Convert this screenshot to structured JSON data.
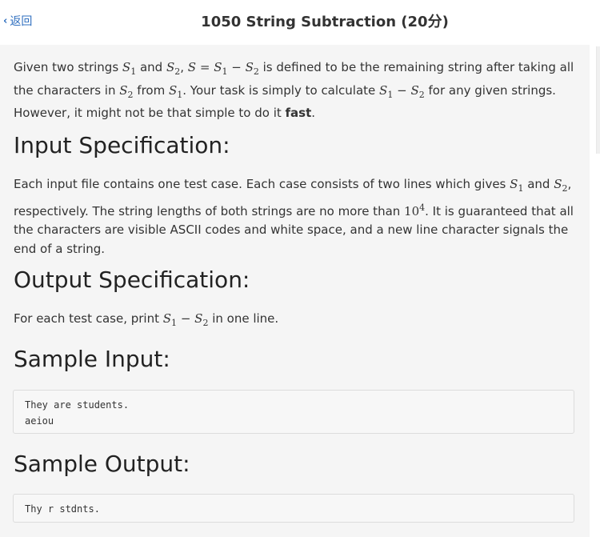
{
  "header": {
    "back_label": "返回",
    "title": "1050 String Subtraction (20分)"
  },
  "intro": {
    "t1": "Given two strings ",
    "t2": " and ",
    "t3": ", ",
    "t4": " is defined to be the remaining string after taking all the characters in ",
    "t5": " from ",
    "t6": ". Your task is simply to calculate ",
    "t7": " for any given strings. However, it might not be that simple to do it ",
    "bold": "fast",
    "t8": "."
  },
  "input_spec": {
    "heading": "Input Specification:",
    "t1": "Each input file contains one test case. Each case consists of two lines which gives ",
    "t2": " and ",
    "t3": ", respectively. The string lengths of both strings are no more than ",
    "t4": ". It is guaranteed that all the characters are visible ASCII codes and white space, and a new line character signals the end of a string."
  },
  "output_spec": {
    "heading": "Output Specification:",
    "t1": "For each test case, print ",
    "t2": " in one line."
  },
  "sample_input": {
    "heading": "Sample Input:",
    "code": "They are students.\naeiou"
  },
  "sample_output": {
    "heading": "Sample Output:",
    "code": "Thy r stdnts."
  },
  "math": {
    "s": "S",
    "sub1": "1",
    "sub2": "2",
    "eq": " = ",
    "minus": " − ",
    "ten": "10",
    "exp": "4"
  },
  "colors": {
    "link": "#2f6fbf",
    "content_bg": "#f5f5f5",
    "code_bg": "#f7f7f7"
  }
}
